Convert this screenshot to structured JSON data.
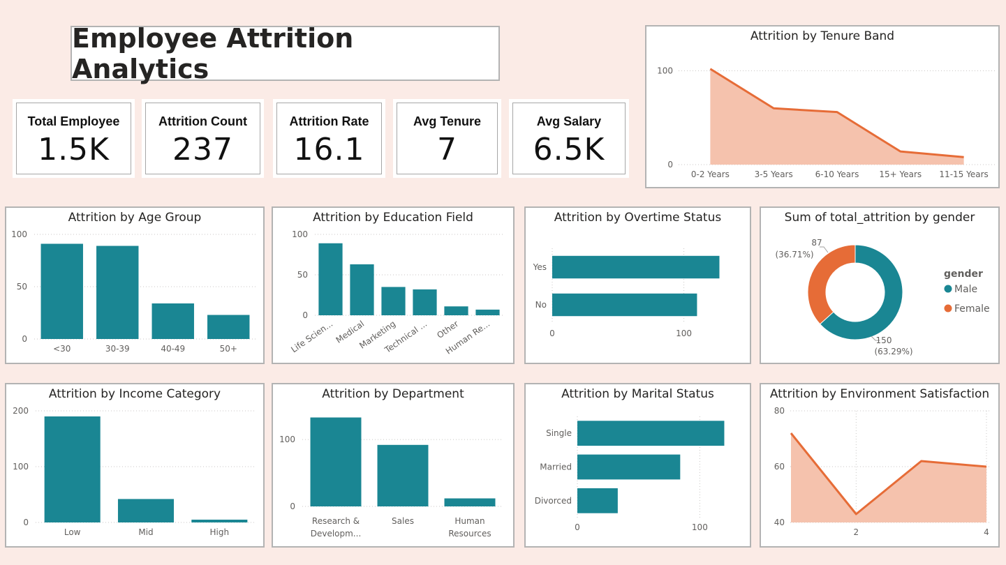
{
  "dashboard": {
    "title": "Employee Attrition Analytics"
  },
  "kpis": [
    {
      "label": "Total Employee",
      "value": "1.5K"
    },
    {
      "label": "Attrition Count",
      "value": "237"
    },
    {
      "label": "Attrition Rate",
      "value": "16.1"
    },
    {
      "label": "Avg Tenure",
      "value": "7"
    },
    {
      "label": "Avg Salary",
      "value": "6.5K"
    }
  ],
  "colors": {
    "teal": "#1a8693",
    "orange": "#e66c37",
    "area_fill": "#f5c2ad",
    "background": "#fbebe6"
  },
  "chart_data": [
    {
      "id": "tenure",
      "type": "area",
      "title": "Attrition by Tenure Band",
      "categories": [
        "0-2 Years",
        "3-5 Years",
        "6-10 Years",
        "15+ Years",
        "11-15 Years"
      ],
      "values": [
        102,
        60,
        56,
        14,
        8
      ],
      "ylim": [
        0,
        110
      ],
      "yticks": [
        "0",
        "100"
      ],
      "grid": true
    },
    {
      "id": "age",
      "type": "bar",
      "title": "Attrition by Age Group",
      "categories": [
        "<30",
        "30-39",
        "40-49",
        "50+"
      ],
      "values": [
        91,
        89,
        34,
        23
      ],
      "ylim": [
        0,
        100
      ],
      "yticks": [
        "0",
        "50",
        "100"
      ],
      "grid": true
    },
    {
      "id": "education",
      "type": "bar",
      "title": "Attrition by Education Field",
      "categories": [
        "Life Scien...",
        "Medical",
        "Marketing",
        "Technical ...",
        "Other",
        "Human Re..."
      ],
      "values": [
        89,
        63,
        35,
        32,
        11,
        7
      ],
      "ylim": [
        0,
        100
      ],
      "yticks": [
        "0",
        "50",
        "100"
      ],
      "grid": true
    },
    {
      "id": "overtime",
      "type": "bar",
      "orientation": "horizontal",
      "title": "Attrition by Overtime Status",
      "categories": [
        "Yes",
        "No"
      ],
      "values": [
        127,
        110
      ],
      "xlim": [
        0,
        140
      ],
      "xticks": [
        "0",
        "100"
      ],
      "grid": true
    },
    {
      "id": "gender",
      "type": "pie",
      "title": "Sum of total_attrition by gender",
      "legend_title": "gender",
      "legend_position": "right",
      "slices": [
        {
          "name": "Male",
          "value": 150,
          "label": "150",
          "pct": "(63.29%)"
        },
        {
          "name": "Female",
          "value": 87,
          "label": "87",
          "pct": "(36.71%)"
        }
      ]
    },
    {
      "id": "income",
      "type": "bar",
      "title": "Attrition by Income Category",
      "categories": [
        "Low",
        "Mid",
        "High"
      ],
      "values": [
        190,
        42,
        5
      ],
      "ylim": [
        0,
        200
      ],
      "yticks": [
        "0",
        "100",
        "200"
      ],
      "grid": true
    },
    {
      "id": "department",
      "type": "bar",
      "title": "Attrition by Department",
      "categories": [
        "Research & Developm...",
        "Sales",
        "Human Resources"
      ],
      "values": [
        133,
        92,
        12
      ],
      "ylim": [
        0,
        145
      ],
      "yticks": [
        "0",
        "100"
      ],
      "grid": true
    },
    {
      "id": "marital",
      "type": "bar",
      "orientation": "horizontal",
      "title": "Attrition by Marital Status",
      "categories": [
        "Single",
        "Married",
        "Divorced"
      ],
      "values": [
        120,
        84,
        33
      ],
      "xlim": [
        0,
        130
      ],
      "xticks": [
        "0",
        "100"
      ],
      "grid": true
    },
    {
      "id": "environment",
      "type": "area",
      "title": "Attrition by Environment Satisfaction",
      "x": [
        1,
        2,
        3,
        4
      ],
      "values": [
        72,
        43,
        62,
        60
      ],
      "xlim": [
        1,
        4
      ],
      "ylim": [
        40,
        80
      ],
      "xticks": [
        "2",
        "4"
      ],
      "yticks": [
        "40",
        "60",
        "80"
      ],
      "grid": true
    }
  ]
}
